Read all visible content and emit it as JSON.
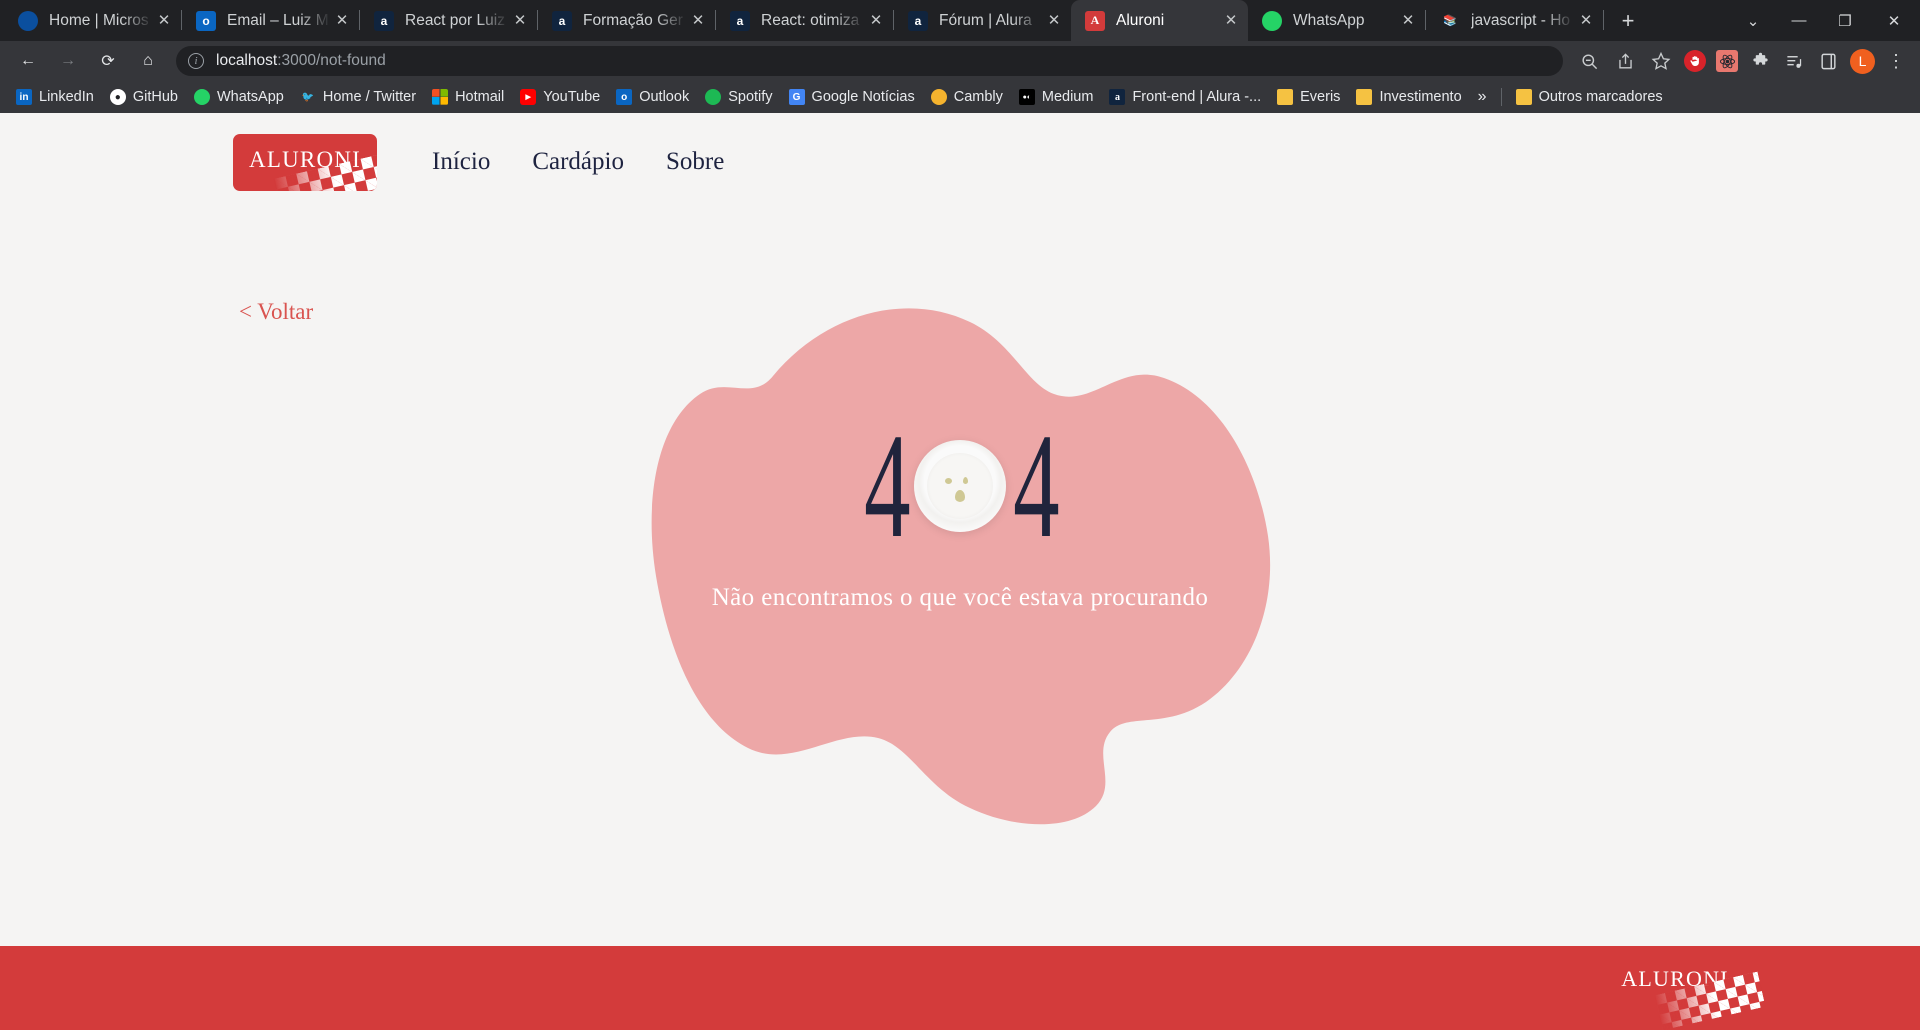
{
  "browser": {
    "tabs": [
      {
        "title": "Home | Micros",
        "icon": "microsoft-edge-icon",
        "icon_bg": "#0b4f9e",
        "icon_text": "",
        "active": false
      },
      {
        "title": "Email – Luiz M",
        "icon": "outlook-icon",
        "icon_bg": "#0a66c2",
        "icon_text": "o",
        "active": false
      },
      {
        "title": "React por Luiz",
        "icon": "alura-icon",
        "icon_bg": "#10243e",
        "icon_text": "a",
        "active": false
      },
      {
        "title": "Formação Ger",
        "icon": "alura-icon",
        "icon_bg": "#10243e",
        "icon_text": "a",
        "active": false
      },
      {
        "title": "React: otimiza",
        "icon": "alura-icon",
        "icon_bg": "#10243e",
        "icon_text": "a",
        "active": false
      },
      {
        "title": "Fórum | Alura",
        "icon": "alura-icon",
        "icon_bg": "#10243e",
        "icon_text": "a",
        "active": false
      },
      {
        "title": "Aluroni",
        "icon": "aluroni-icon",
        "icon_bg": "#d33b3b",
        "icon_text": "A",
        "active": true
      },
      {
        "title": "WhatsApp",
        "icon": "whatsapp-icon",
        "icon_bg": "#25d366",
        "icon_text": "",
        "active": false
      },
      {
        "title": "javascript - Ho",
        "icon": "stackoverflow-icon",
        "icon_bg": "#202124",
        "icon_text": "",
        "active": false
      }
    ],
    "tab_close_label": "✕",
    "newtab_label": "+",
    "window_controls": {
      "tab_search": "⌄",
      "minimize": "—",
      "maximize": "❐",
      "close": "✕"
    },
    "toolbar": {
      "back": "←",
      "forward": "→",
      "reload": "⟳",
      "home": "⌂",
      "url_host": "localhost",
      "url_rest": ":3000/not-found",
      "site_info_icon": "ⓘ",
      "icons": [
        {
          "name": "zoom-out-icon",
          "glyph": "⊖"
        },
        {
          "name": "share-icon",
          "glyph": "⇪"
        },
        {
          "name": "bookmark-star-icon",
          "glyph": "☆"
        },
        {
          "name": "adblock-icon",
          "glyph": "✋"
        },
        {
          "name": "react-devtools-icon",
          "glyph": "⚛"
        },
        {
          "name": "extensions-puzzle-icon",
          "glyph": "🧩"
        },
        {
          "name": "reading-list-icon",
          "glyph": "☰"
        },
        {
          "name": "sidebar-icon",
          "glyph": "▯"
        },
        {
          "name": "profile-avatar",
          "glyph": "L"
        },
        {
          "name": "chrome-menu-icon",
          "glyph": "⋮"
        }
      ]
    },
    "bookmarks": [
      {
        "label": "LinkedIn",
        "icon": "linkedin-icon",
        "bg": "#0a66c2",
        "ch": "in"
      },
      {
        "label": "GitHub",
        "icon": "github-icon",
        "bg": "#ffffff",
        "ch": ""
      },
      {
        "label": "WhatsApp",
        "icon": "whatsapp-icon",
        "bg": "#25d366",
        "ch": ""
      },
      {
        "label": "Home / Twitter",
        "icon": "twitter-icon",
        "bg": "#1d9bf0",
        "ch": ""
      },
      {
        "label": "Hotmail",
        "icon": "microsoft-icon",
        "bg": "#35363a",
        "ch": ""
      },
      {
        "label": "YouTube",
        "icon": "youtube-icon",
        "bg": "#ff0000",
        "ch": "▶"
      },
      {
        "label": "Outlook",
        "icon": "outlook-icon",
        "bg": "#0a66c2",
        "ch": "o"
      },
      {
        "label": "Spotify",
        "icon": "spotify-icon",
        "bg": "#1db954",
        "ch": ""
      },
      {
        "label": "Google Notícias",
        "icon": "google-news-icon",
        "bg": "#4285f4",
        "ch": "G"
      },
      {
        "label": "Cambly",
        "icon": "cambly-icon",
        "bg": "#f5b32e",
        "ch": ""
      },
      {
        "label": "Medium",
        "icon": "medium-icon",
        "bg": "#000000",
        "ch": ""
      },
      {
        "label": "Front-end | Alura -...",
        "icon": "alura-icon",
        "bg": "#10243e",
        "ch": "a"
      },
      {
        "label": "Everis",
        "icon": "folder-icon",
        "bg": "#f5c242",
        "ch": ""
      },
      {
        "label": "Investimento",
        "icon": "folder-icon",
        "bg": "#f5c242",
        "ch": ""
      }
    ],
    "bookmarks_overflow": "»",
    "other_bookmarks": {
      "label": "Outros marcadores",
      "icon": "folder-icon"
    }
  },
  "site": {
    "logo_text": "ALURONI",
    "nav": [
      {
        "label": "Início"
      },
      {
        "label": "Cardápio"
      },
      {
        "label": "Sobre"
      }
    ],
    "back_link": "< Voltar",
    "error": {
      "code_left": "4",
      "code_right": "4",
      "message": "Não encontramos o que você estava procurando"
    },
    "footer_logo_text": "ALURONI",
    "colors": {
      "brand_red": "#d33b3b",
      "blob_pink": "#eda7a7",
      "nav_navy": "#1e2340",
      "page_bg": "#f5f4f3",
      "crumb": "#cfc894"
    }
  }
}
